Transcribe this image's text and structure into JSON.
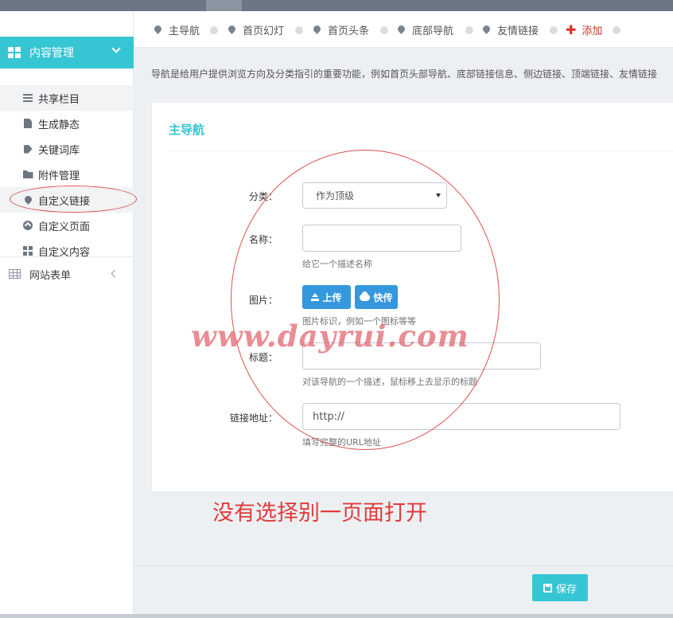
{
  "sidebar": {
    "menu_title": "内容管理",
    "items": [
      {
        "label": "共享栏目",
        "icon": "list-icon"
      },
      {
        "label": "生成静态",
        "icon": "file-icon"
      },
      {
        "label": "关键词库",
        "icon": "tag-icon"
      },
      {
        "label": "附件管理",
        "icon": "folder-icon"
      },
      {
        "label": "自定义链接",
        "icon": "map-marker-icon"
      },
      {
        "label": "自定义页面",
        "icon": "circle-up-icon"
      },
      {
        "label": "自定义内容",
        "icon": "blocks-icon"
      }
    ],
    "section2": {
      "label": "网站表单",
      "icon": "table-icon"
    }
  },
  "tabs": [
    {
      "label": "主导航"
    },
    {
      "label": "首页幻灯"
    },
    {
      "label": "首页头条"
    },
    {
      "label": "底部导航"
    },
    {
      "label": "友情链接"
    }
  ],
  "add_tab": "添加",
  "description": "导航是给用户提供浏览方向及分类指引的重要功能，例如首页头部导航、底部链接信息、侧边链接、顶端链接、友情链接",
  "panel": {
    "title": "主导航",
    "category": {
      "label": "分类：",
      "value": "作为顶级"
    },
    "name": {
      "label": "名称：",
      "value": "",
      "help": "给它一个描述名称"
    },
    "image": {
      "label": "图片：",
      "upload": "上传",
      "quick": "快传",
      "help": "图片标识，例如一个图标等等"
    },
    "title_field": {
      "label": "标题：",
      "value": "",
      "help": "对该导航的一个描述，鼠标移上去显示的标题"
    },
    "url": {
      "label": "链接地址：",
      "value": "http://",
      "help": "填写完整的URL地址"
    }
  },
  "save_label": "保存",
  "annotation": {
    "watermark": "www.dayrui.com",
    "note": "没有选择别一页面打开",
    "color": "#e23b3b"
  },
  "colors": {
    "accent": "#36c6d3",
    "primary_button": "#3598dc",
    "topbar": "#6b7784"
  }
}
